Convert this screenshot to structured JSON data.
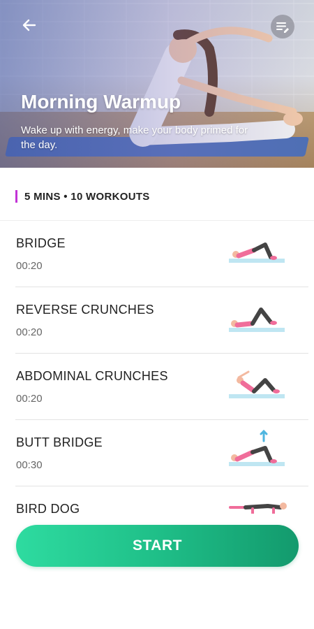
{
  "header": {
    "title": "Morning Warmup",
    "subtitle": "Wake up with energy, make your body primed for the day.",
    "back_icon": "arrow-left-icon",
    "edit_icon": "edit-list-icon"
  },
  "summary": {
    "text": "5 MINS • 10 WORKOUTS",
    "accent_color": "#c233d6"
  },
  "workouts": [
    {
      "name": "BRIDGE",
      "duration": "00:20",
      "icon": "bridge-pose-icon"
    },
    {
      "name": "REVERSE CRUNCHES",
      "duration": "00:20",
      "icon": "reverse-crunch-icon"
    },
    {
      "name": "ABDOMINAL CRUNCHES",
      "duration": "00:20",
      "icon": "abdominal-crunch-icon"
    },
    {
      "name": "BUTT BRIDGE",
      "duration": "00:30",
      "icon": "butt-bridge-icon"
    },
    {
      "name": "BIRD DOG",
      "duration": "",
      "icon": "bird-dog-icon"
    }
  ],
  "start_button": {
    "label": "START",
    "color": "#1fbf88"
  }
}
